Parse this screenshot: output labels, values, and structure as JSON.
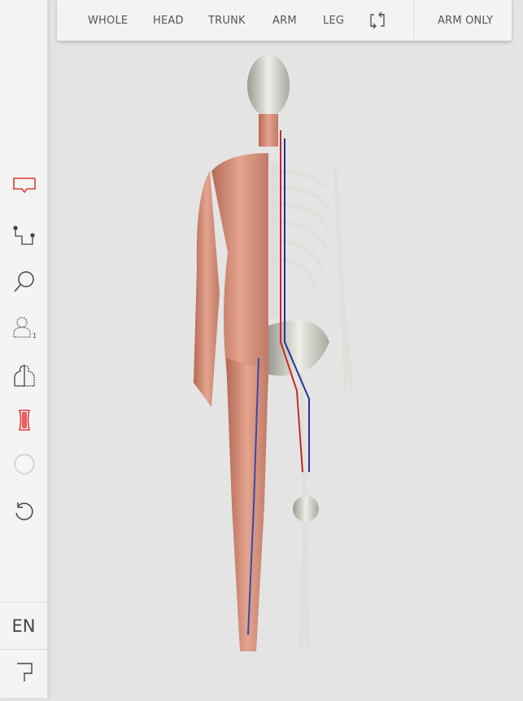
{
  "toolbar": {
    "items": [
      {
        "label": "WHOLE"
      },
      {
        "label": "HEAD"
      },
      {
        "label": "TRUNK"
      },
      {
        "label": "ARM"
      },
      {
        "label": "LEG"
      }
    ],
    "swap_icon": "swap-arrows-icon",
    "mode_label": "ARM ONLY"
  },
  "sidebar": {
    "items": [
      {
        "icon": "comment-icon",
        "active": true
      },
      {
        "icon": "path-connector-icon"
      },
      {
        "icon": "search-icon"
      },
      {
        "icon": "person-layer-icon",
        "badge": "1"
      },
      {
        "icon": "half-body-icon"
      },
      {
        "icon": "muscle-layer-icon",
        "active": true
      },
      {
        "icon": "circle-icon"
      },
      {
        "icon": "undo-icon"
      }
    ],
    "language": "EN",
    "bottom_icon": "flag-icon"
  },
  "colors": {
    "accent": "#e53935",
    "icon": "#444444"
  }
}
